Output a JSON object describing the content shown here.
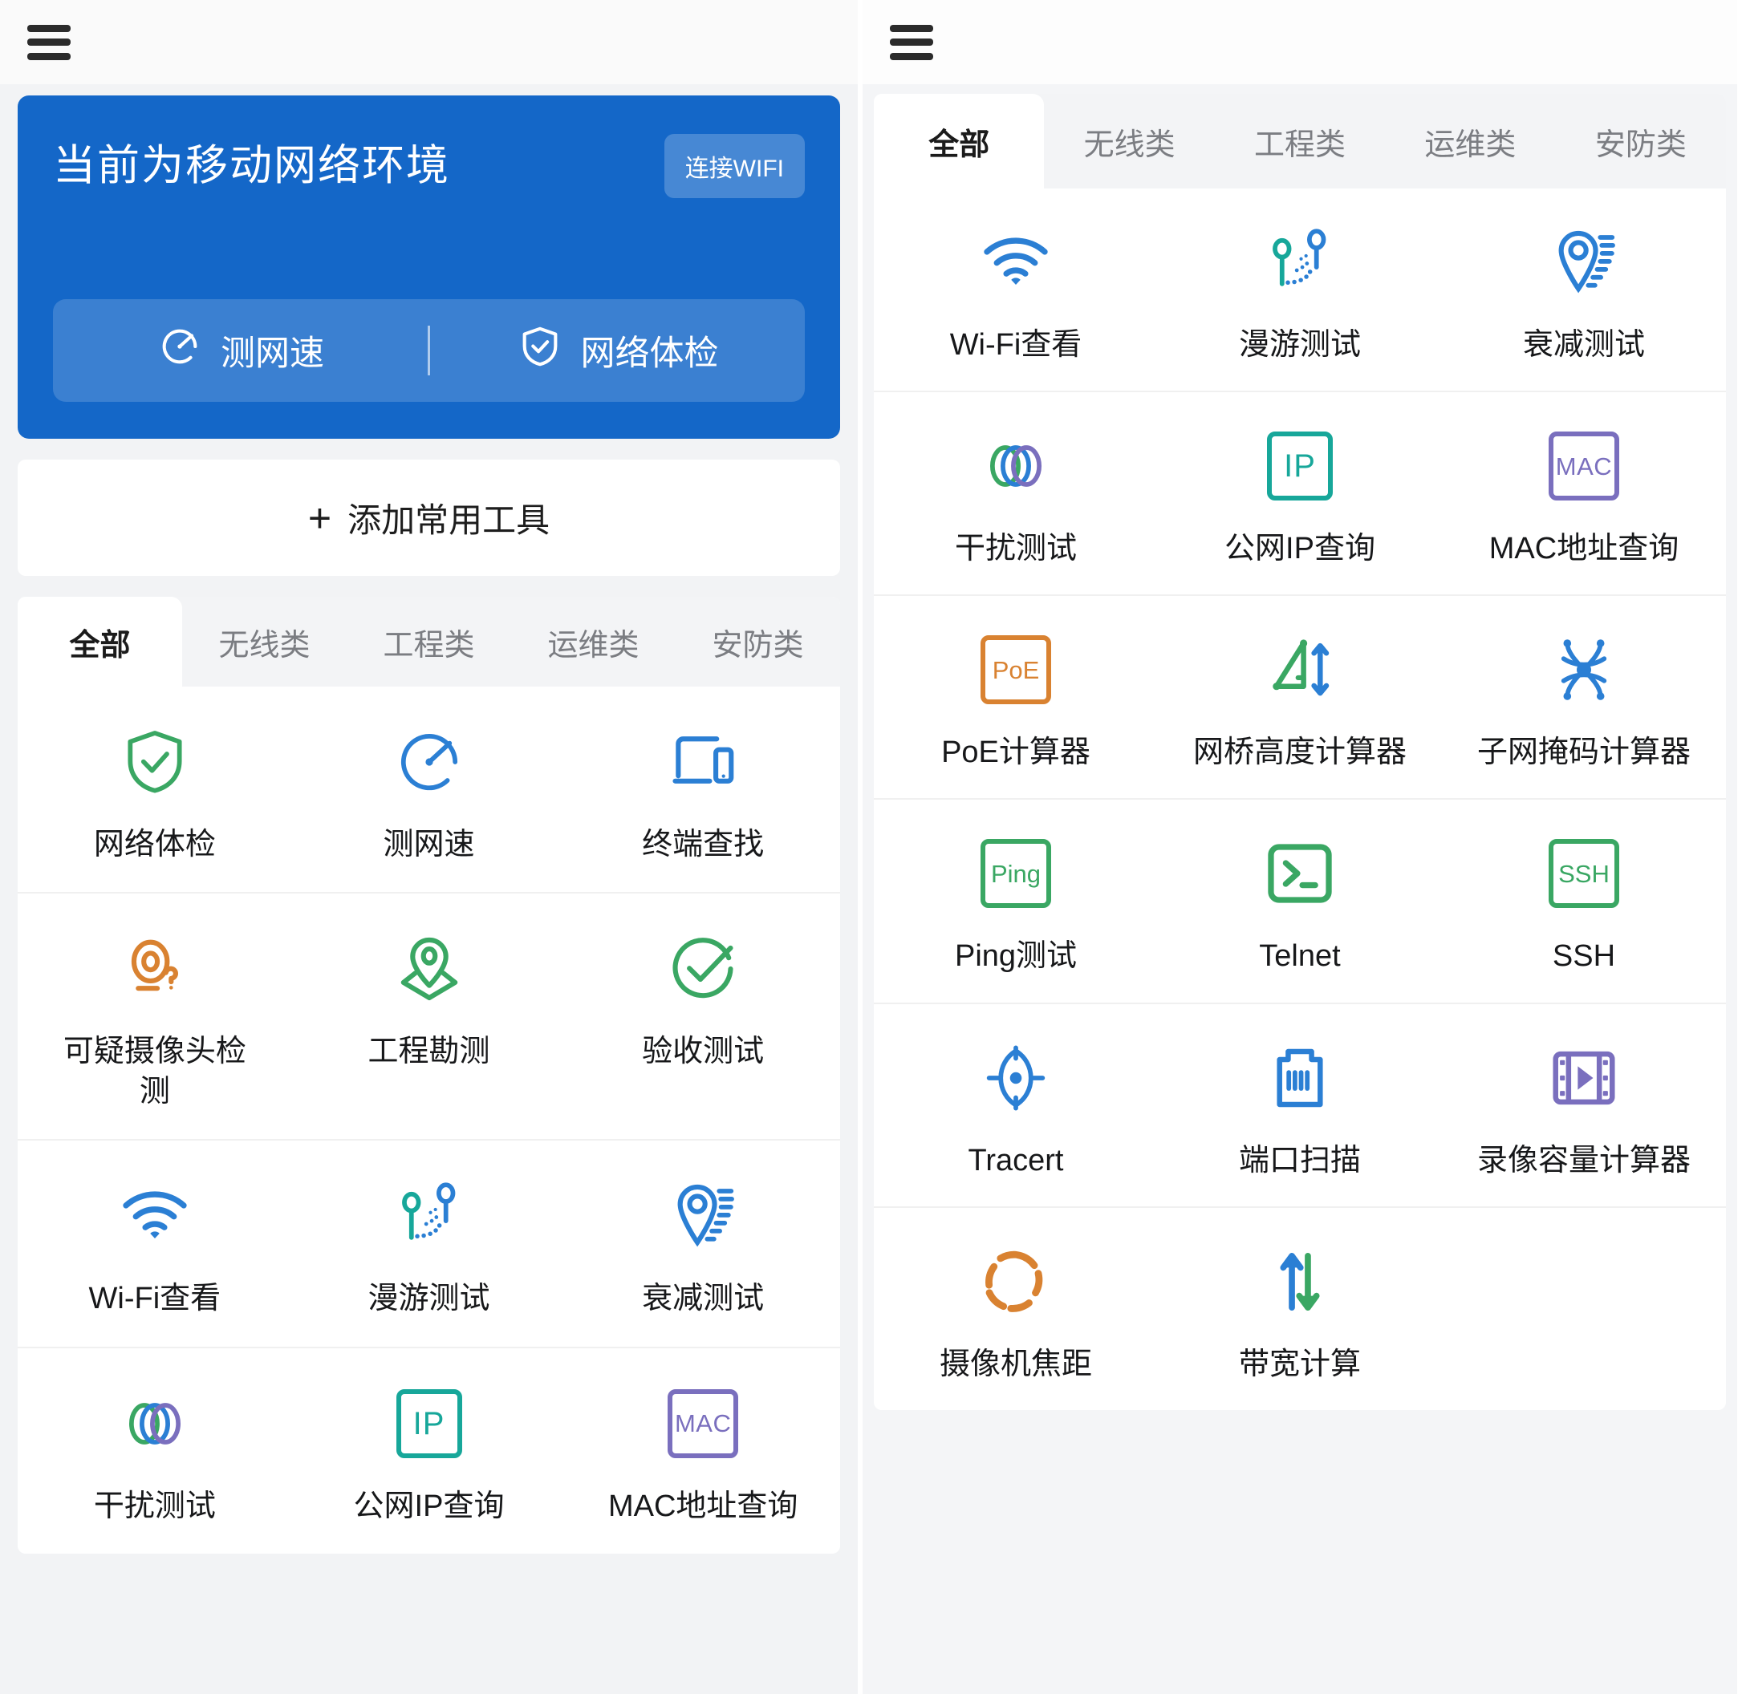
{
  "colors": {
    "brand_blue": "#1467c8",
    "green": "#3aa763",
    "blue": "#2b7fd4",
    "teal": "#17a79a",
    "purple": "#7a6fbe",
    "orange": "#d98231",
    "text": "#17181a",
    "muted": "#7b7d82"
  },
  "left_panel": {
    "menu_icon": "hamburger-icon",
    "banner": {
      "title": "当前为移动网络环境",
      "wifi_button": "连接WIFI",
      "actions": [
        {
          "label": "测网速",
          "icon": "speedometer-icon"
        },
        {
          "label": "网络体检",
          "icon": "shield-check-icon"
        }
      ]
    },
    "add_tools": {
      "label": "添加常用工具",
      "icon": "plus-icon"
    },
    "tabs": [
      {
        "label": "全部",
        "active": true
      },
      {
        "label": "无线类",
        "active": false
      },
      {
        "label": "工程类",
        "active": false
      },
      {
        "label": "运维类",
        "active": false
      },
      {
        "label": "安防类",
        "active": false
      }
    ],
    "tools": [
      [
        {
          "label": "网络体检",
          "icon": "shield-check-icon",
          "color": "#3aa763"
        },
        {
          "label": "测网速",
          "icon": "speedometer-icon",
          "color": "#2b7fd4"
        },
        {
          "label": "终端查找",
          "icon": "devices-icon",
          "color": "#2b7fd4"
        }
      ],
      [
        {
          "label": "可疑摄像头检测",
          "icon": "camera-question-icon",
          "color": "#d98231"
        },
        {
          "label": "工程勘测",
          "icon": "survey-pin-icon",
          "color": "#3aa763"
        },
        {
          "label": "验收测试",
          "icon": "circle-check-icon",
          "color": "#3aa763"
        }
      ],
      [
        {
          "label": "Wi-Fi查看",
          "icon": "wifi-icon",
          "color": "#2b7fd4"
        },
        {
          "label": "漫游测试",
          "icon": "roaming-icon",
          "color": "#2b7fd4"
        },
        {
          "label": "衰减测试",
          "icon": "attenuation-pin-icon",
          "color": "#2b7fd4"
        }
      ],
      [
        {
          "label": "干扰测试",
          "icon": "rings-icon",
          "color": "#3aa763"
        },
        {
          "label": "公网IP查询",
          "icon": "ip-badge-icon",
          "color": "#17a79a"
        },
        {
          "label": "MAC地址查询",
          "icon": "mac-badge-icon",
          "color": "#7a6fbe"
        }
      ]
    ]
  },
  "right_panel": {
    "menu_icon": "hamburger-icon",
    "tabs": [
      {
        "label": "全部",
        "active": true
      },
      {
        "label": "无线类",
        "active": false
      },
      {
        "label": "工程类",
        "active": false
      },
      {
        "label": "运维类",
        "active": false
      },
      {
        "label": "安防类",
        "active": false
      }
    ],
    "tools": [
      [
        {
          "label": "Wi-Fi查看",
          "icon": "wifi-icon",
          "color": "#2b7fd4"
        },
        {
          "label": "漫游测试",
          "icon": "roaming-icon",
          "color": "#2b7fd4"
        },
        {
          "label": "衰减测试",
          "icon": "attenuation-pin-icon",
          "color": "#2b7fd4"
        }
      ],
      [
        {
          "label": "干扰测试",
          "icon": "rings-icon",
          "color": "#3aa763"
        },
        {
          "label": "公网IP查询",
          "icon": "ip-badge-icon",
          "color": "#17a79a"
        },
        {
          "label": "MAC地址查询",
          "icon": "mac-badge-icon",
          "color": "#7a6fbe"
        }
      ],
      [
        {
          "label": "PoE计算器",
          "icon": "poe-badge-icon",
          "color": "#d98231"
        },
        {
          "label": "网桥高度计算器",
          "icon": "bridge-height-icon",
          "color": "#3aa763"
        },
        {
          "label": "子网掩码计算器",
          "icon": "subnet-mask-icon",
          "color": "#2b7fd4"
        }
      ],
      [
        {
          "label": "Ping测试",
          "icon": "ping-badge-icon",
          "color": "#3aa763"
        },
        {
          "label": "Telnet",
          "icon": "terminal-icon",
          "color": "#3aa763"
        },
        {
          "label": "SSH",
          "icon": "ssh-badge-icon",
          "color": "#3aa763"
        }
      ],
      [
        {
          "label": "Tracert",
          "icon": "crosshair-icon",
          "color": "#2b7fd4"
        },
        {
          "label": "端口扫描",
          "icon": "rj45-port-icon",
          "color": "#2b7fd4"
        },
        {
          "label": "录像容量计算器",
          "icon": "film-play-icon",
          "color": "#7a6fbe"
        }
      ],
      [
        {
          "label": "摄像机焦距",
          "icon": "aperture-icon",
          "color": "#d98231"
        },
        {
          "label": "带宽计算",
          "icon": "bandwidth-arrows-icon",
          "color": "#2b7fd4"
        },
        {
          "label": "",
          "icon": "",
          "color": ""
        }
      ]
    ]
  }
}
